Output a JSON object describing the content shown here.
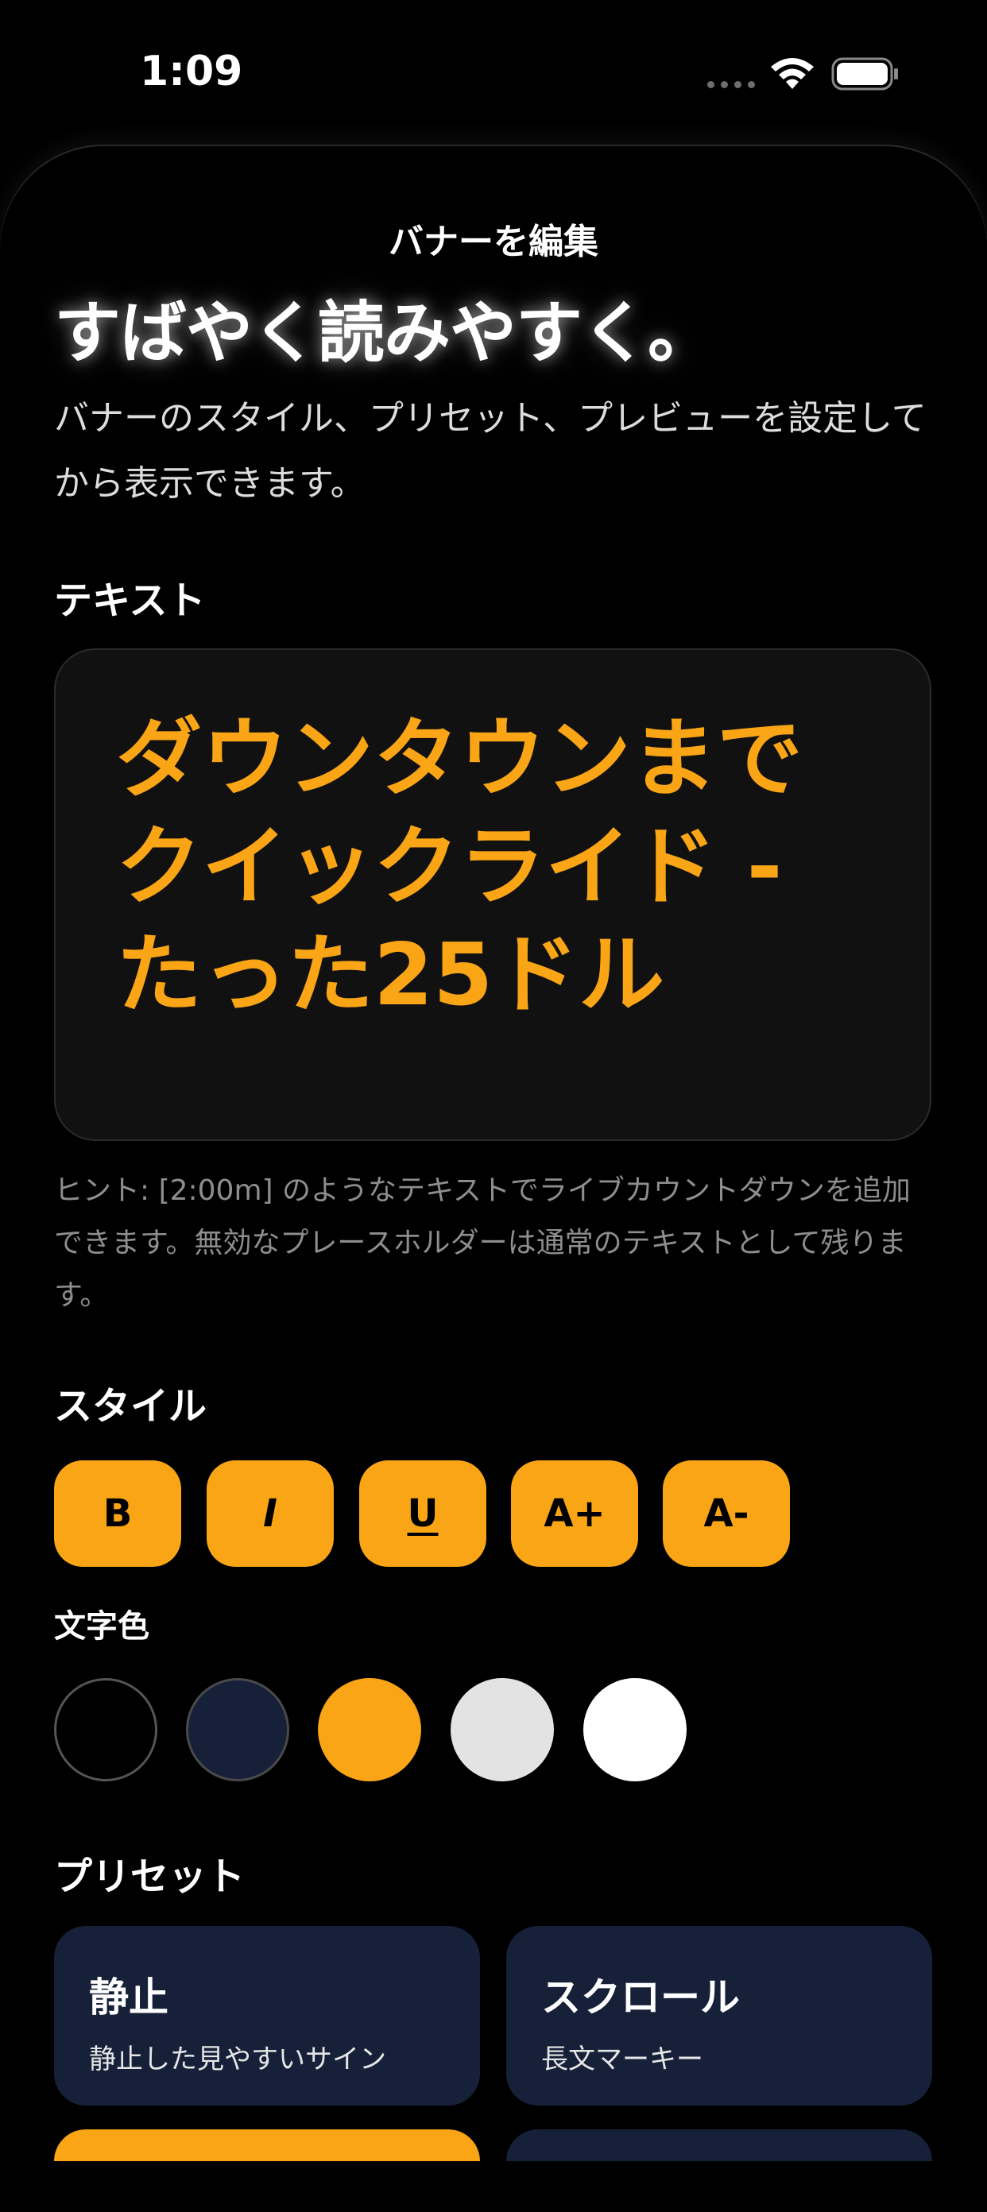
{
  "status_bar": {
    "time": "1:09"
  },
  "sheet": {
    "title": "バナーを編集"
  },
  "hero": {
    "title": "すばやく読みやすく。",
    "subtitle": "バナーのスタイル、プリセット、プレビューを設定してから表示できます。"
  },
  "text_section": {
    "label": "テキスト",
    "value": "ダウンタウンまでクイックライド - たった25ドル",
    "hint": "ヒント: [2:00m] のようなテキストでライブカウントダウンを追加できます。無効なプレースホルダーは通常のテキストとして残ります。"
  },
  "style_section": {
    "label": "スタイル",
    "buttons": [
      {
        "label": "B"
      },
      {
        "label": "I"
      },
      {
        "label": "U"
      },
      {
        "label": "A+"
      },
      {
        "label": "A-"
      }
    ]
  },
  "text_color": {
    "label": "文字色",
    "swatches": [
      "#000000",
      "#162038",
      "#f9a516",
      "#e3e3e3",
      "#ffffff"
    ]
  },
  "presets": {
    "label": "プリセット",
    "items": [
      {
        "title": "静止",
        "subtitle": "静止した見やすいサイン"
      },
      {
        "title": "スクロール",
        "subtitle": "長文マーキー"
      }
    ]
  },
  "colors": {
    "accent": "#f9a516",
    "card": "#162038",
    "background": "#000000"
  }
}
